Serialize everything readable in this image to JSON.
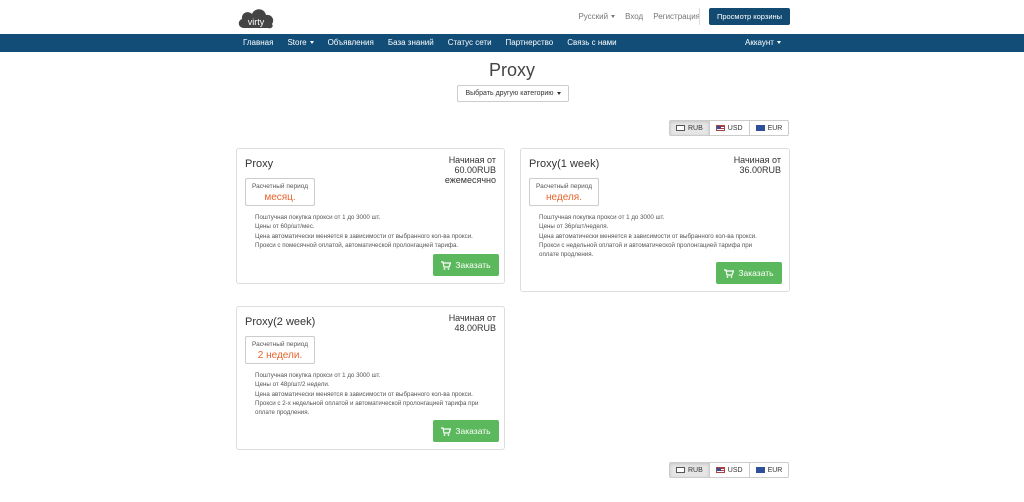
{
  "brand": {
    "logo_text": "virty"
  },
  "top_links": {
    "language": "Русский",
    "login": "Вход",
    "register": "Регистрация",
    "cart_button": "Просмотр корзины"
  },
  "nav": {
    "items": [
      {
        "label": "Главная"
      },
      {
        "label": "Store",
        "dropdown": true
      },
      {
        "label": "Объявления"
      },
      {
        "label": "База знаний"
      },
      {
        "label": "Статус сети"
      },
      {
        "label": "Партнерство"
      },
      {
        "label": "Связь с нами"
      }
    ],
    "account": "Аккаунт"
  },
  "page": {
    "title": "Proxy",
    "category_button": "Выбрать другую категорию"
  },
  "currency": {
    "options": [
      {
        "code": "RUB",
        "icon": "rub-flag-icon",
        "active": true
      },
      {
        "code": "USD",
        "icon": "us-flag-icon",
        "active": false
      },
      {
        "code": "EUR",
        "icon": "eu-flag-icon",
        "active": false
      }
    ]
  },
  "products": [
    {
      "title": "Proxy",
      "price_prefix": "Начиная от",
      "price": "60.00RUB",
      "price_suffix": "ежемесячно",
      "period_label": "Расчетный период",
      "period_value": "месяц.",
      "description": [
        "Поштучная покупка прокси от 1 до 3000 шт.",
        "Цены от 60р/шт/мес.",
        "Цена автоматически меняется в зависимости от выбранного кол-ва прокси.",
        "Прокси с помесячной оплатой, автоматической пролонгацией тарифа."
      ],
      "order_button": "Заказать"
    },
    {
      "title": "Proxy(1 week)",
      "price_prefix": "Начиная от",
      "price": "36.00RUB",
      "price_suffix": "",
      "period_label": "Расчетный период",
      "period_value": "неделя.",
      "description": [
        "Поштучная покупка прокси от 1 до 3000 шт.",
        "Цены от 36р/шт/неделя.",
        "Цена автоматически меняется в зависимости от выбранного кол-ва прокси.",
        "Прокси с недельной оплатой и автоматической пролонгацией тарифа при",
        "оплате продления."
      ],
      "order_button": "Заказать"
    },
    {
      "title": "Proxy(2 week)",
      "price_prefix": "Начиная от",
      "price": "48.00RUB",
      "price_suffix": "",
      "period_label": "Расчетный период",
      "period_value": "2 недели.",
      "description": [
        "Поштучная покупка прокси от 1 до 3000 шт.",
        "Цены от 48р/шт/2 недели.",
        "Цена автоматически меняется в зависимости от выбранного кол-ва прокси.",
        "Прокси с 2-х недельной оплатой и автоматической пролонгацией тарифа при",
        "оплате продления."
      ],
      "order_button": "Заказать"
    }
  ],
  "colors": {
    "navbar": "#124d77",
    "cart_button": "#124a72",
    "order_button": "#5cb85c",
    "period_value": "#e7642b"
  }
}
